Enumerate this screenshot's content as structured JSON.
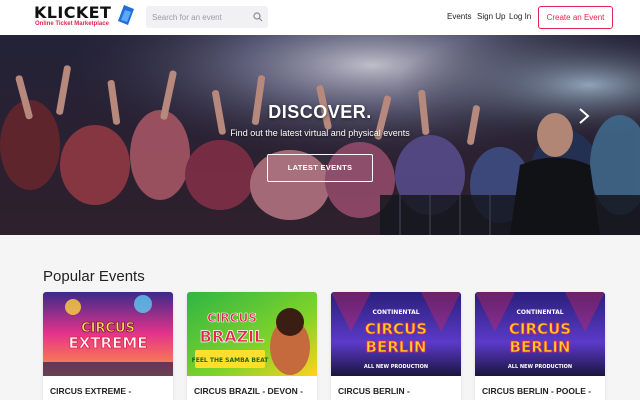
{
  "brand": {
    "name": "KLICKET",
    "tagline": "Online Ticket Marketplace",
    "accent_color": "#e2264d",
    "mark_color": "#1e6fd9"
  },
  "search": {
    "placeholder": "Search for an event",
    "value": "",
    "icon": "search-icon"
  },
  "nav": {
    "events": "Events",
    "signup": "Sign Up",
    "login": "Log In",
    "create": "Create an Event"
  },
  "hero": {
    "title": "DISCOVER.",
    "subtitle": "Find out the latest virtual and physical events",
    "button": "LATEST EVENTS",
    "next_icon": "chevron-right-icon"
  },
  "popular": {
    "heading": "Popular Events",
    "events": [
      {
        "title": "CIRCUS EXTREME -",
        "poster_text_1": "CIRCUS",
        "poster_text_2": "EXTREME"
      },
      {
        "title": "CIRCUS BRAZIL - DEVON -",
        "poster_text_1": "CIRCUS",
        "poster_text_2": "BRAZIL",
        "poster_tag": "FEEL THE SAMBA BEAT"
      },
      {
        "title": "CIRCUS BERLIN -",
        "poster_text_0": "CONTINENTAL",
        "poster_text_1": "CIRCUS",
        "poster_text_2": "BERLIN",
        "poster_tag": "ALL NEW PRODUCTION"
      },
      {
        "title": "CIRCUS BERLIN - POOLE -",
        "poster_text_0": "CONTINENTAL",
        "poster_text_1": "CIRCUS",
        "poster_text_2": "BERLIN",
        "poster_tag": "ALL NEW PRODUCTION"
      }
    ]
  }
}
